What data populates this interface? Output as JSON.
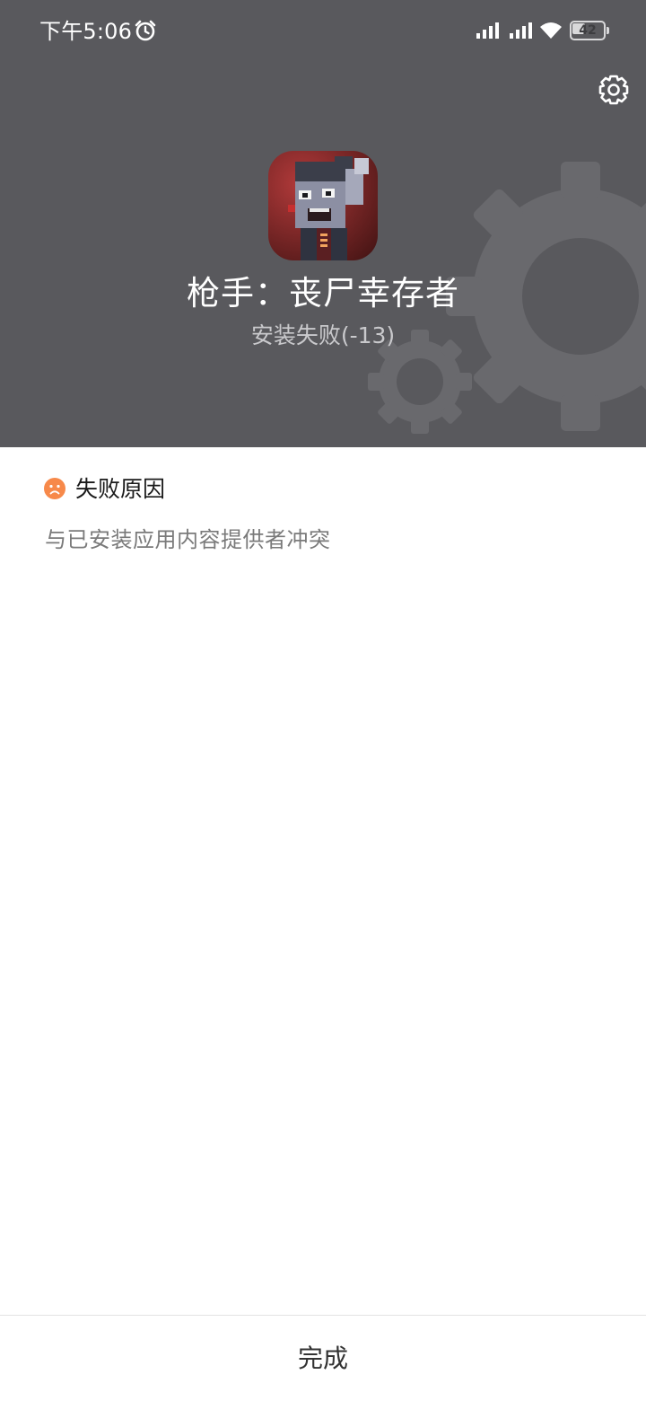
{
  "status_bar": {
    "time": "下午5:06",
    "battery": "42",
    "battery_level": 0.42,
    "icons": [
      "alarm-icon",
      "cellular-signal-icon",
      "cellular-signal-icon",
      "wifi-icon",
      "battery-icon"
    ]
  },
  "header": {
    "settings_icon": "gear-icon",
    "app_title": "枪手：丧尸幸存者",
    "install_status": "安装失败(-13)",
    "background_color": "#59595d"
  },
  "failure": {
    "heading": "失败原因",
    "reason": "与已安装应用内容提供者冲突",
    "icon": "sad-face-icon",
    "icon_color": "#f7894a"
  },
  "footer": {
    "done_label": "完成"
  }
}
